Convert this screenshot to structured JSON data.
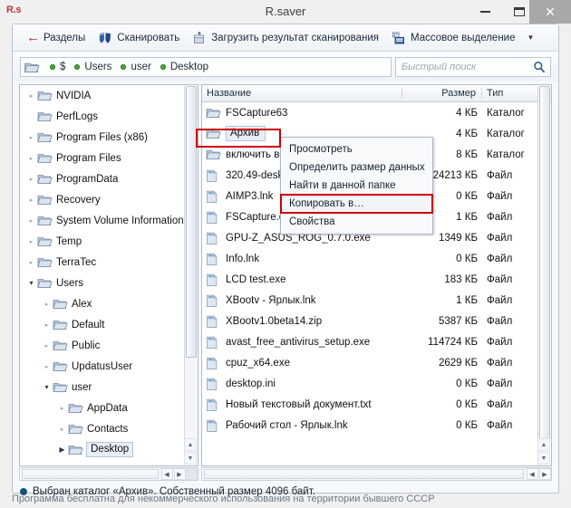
{
  "window": {
    "logo": "R.s",
    "title": "R.saver",
    "buttons": {
      "minimize": "minimize-button",
      "maximize": "maximize-button",
      "close": "✕"
    }
  },
  "toolbar": {
    "items": [
      {
        "label": "Разделы",
        "icon": "back-arrow-icon"
      },
      {
        "label": "Сканировать",
        "icon": "scan-shield-icon"
      },
      {
        "label": "Загрузить результат сканирования",
        "icon": "load-scan-icon"
      },
      {
        "label": "Массовое выделение",
        "icon": "mass-select-icon"
      }
    ],
    "overflow_caret": "▼"
  },
  "path": {
    "folder_icon": "folder-icon",
    "crumbs": [
      "$",
      "Users",
      "user",
      "Desktop"
    ],
    "dot_color": "#49a63c"
  },
  "search": {
    "placeholder": "Быстрый поиск",
    "value": "",
    "icon": "search-icon"
  },
  "tree": {
    "items": [
      {
        "label": "NVIDIA",
        "indent": 1,
        "twisty": "collapsed",
        "selected": false
      },
      {
        "label": "PerfLogs",
        "indent": 1,
        "twisty": "none",
        "selected": false
      },
      {
        "label": "Program Files (x86)",
        "indent": 1,
        "twisty": "collapsed",
        "selected": false
      },
      {
        "label": "Program Files",
        "indent": 1,
        "twisty": "collapsed",
        "selected": false
      },
      {
        "label": "ProgramData",
        "indent": 1,
        "twisty": "collapsed",
        "selected": false
      },
      {
        "label": "Recovery",
        "indent": 1,
        "twisty": "collapsed",
        "selected": false
      },
      {
        "label": "System Volume Information",
        "indent": 1,
        "twisty": "collapsed",
        "selected": false
      },
      {
        "label": "Temp",
        "indent": 1,
        "twisty": "collapsed",
        "selected": false
      },
      {
        "label": "TerraTec",
        "indent": 1,
        "twisty": "collapsed",
        "selected": false
      },
      {
        "label": "Users",
        "indent": 1,
        "twisty": "expanded",
        "selected": false
      },
      {
        "label": "Alex",
        "indent": 2,
        "twisty": "collapsed",
        "selected": false
      },
      {
        "label": "Default",
        "indent": 2,
        "twisty": "collapsed",
        "selected": false
      },
      {
        "label": "Public",
        "indent": 2,
        "twisty": "collapsed",
        "selected": false
      },
      {
        "label": "UpdatusUser",
        "indent": 2,
        "twisty": "collapsed",
        "selected": false
      },
      {
        "label": "user",
        "indent": 2,
        "twisty": "expanded",
        "selected": false
      },
      {
        "label": "AppData",
        "indent": 3,
        "twisty": "collapsed",
        "selected": false
      },
      {
        "label": "Contacts",
        "indent": 3,
        "twisty": "collapsed",
        "selected": false
      },
      {
        "label": "Desktop",
        "indent": 3,
        "twisty": "collapsed-filled",
        "selected": true
      }
    ]
  },
  "filelist": {
    "columns": {
      "name": "Название",
      "size": "Размер",
      "type": "Тип"
    },
    "rows": [
      {
        "name": "FSCapture63",
        "size": "4 КБ",
        "type": "Каталог",
        "icon": "folder-icon",
        "selected": false
      },
      {
        "name": "Архив",
        "size": "4 КБ",
        "type": "Каталог",
        "icon": "folder-icon",
        "selected": true
      },
      {
        "name": "включить встр",
        "size": "8 КБ",
        "type": "Каталог",
        "icon": "folder-icon",
        "selected": false
      },
      {
        "name": "320.49-desktop",
        "size": "224213 КБ",
        "type": "Файл",
        "icon": "file-icon",
        "selected": false
      },
      {
        "name": "AIMP3.lnk",
        "size": "0 КБ",
        "type": "Файл",
        "icon": "file-icon",
        "selected": false
      },
      {
        "name": "FSCapture.exe",
        "size": "1 КБ",
        "type": "Файл",
        "icon": "file-icon",
        "selected": false
      },
      {
        "name": "GPU-Z_ASUS_ROG_0.7.0.exe",
        "size": "1349 КБ",
        "type": "Файл",
        "icon": "file-icon",
        "selected": false
      },
      {
        "name": "Info.lnk",
        "size": "0 КБ",
        "type": "Файл",
        "icon": "file-icon",
        "selected": false
      },
      {
        "name": "LCD test.exe",
        "size": "183 КБ",
        "type": "Файл",
        "icon": "file-icon",
        "selected": false
      },
      {
        "name": "XBootv - Ярлык.lnk",
        "size": "1 КБ",
        "type": "Файл",
        "icon": "file-icon",
        "selected": false
      },
      {
        "name": "XBootv1.0beta14.zip",
        "size": "5387 КБ",
        "type": "Файл",
        "icon": "file-icon",
        "selected": false
      },
      {
        "name": "avast_free_antivirus_setup.exe",
        "size": "114724 КБ",
        "type": "Файл",
        "icon": "file-icon",
        "selected": false
      },
      {
        "name": "cpuz_x64.exe",
        "size": "2629 КБ",
        "type": "Файл",
        "icon": "file-icon",
        "selected": false
      },
      {
        "name": "desktop.ini",
        "size": "0 КБ",
        "type": "Файл",
        "icon": "file-icon",
        "selected": false
      },
      {
        "name": "Новый текстовый документ.txt",
        "size": "0 КБ",
        "type": "Файл",
        "icon": "file-icon",
        "selected": false
      },
      {
        "name": "Рабочий стол - Ярлык.lnk",
        "size": "0 КБ",
        "type": "Файл",
        "icon": "file-icon",
        "selected": false
      }
    ]
  },
  "context_menu": {
    "items": [
      {
        "label": "Просмотреть",
        "highlighted": false
      },
      {
        "label": "Определить размер данных",
        "highlighted": false
      },
      {
        "label": "Найти в данной папке",
        "highlighted": false
      },
      {
        "label": "Копировать в…",
        "highlighted": true
      },
      {
        "label": "Свойства",
        "highlighted": false
      }
    ]
  },
  "status": {
    "message": "Выбран каталог «Архив». Собственный размер 4096 байт.",
    "footnote": "Программа бесплатна для некоммерческого использования на территории бывшего СССР"
  },
  "scrollbars": {
    "left_arrow": "◀",
    "right_arrow": "▶",
    "up_arrow": "▲",
    "down_arrow": "▼"
  },
  "accent": {
    "highlight": "#cc0000",
    "dot": "#49a63c",
    "status_dot": "#14527e"
  }
}
